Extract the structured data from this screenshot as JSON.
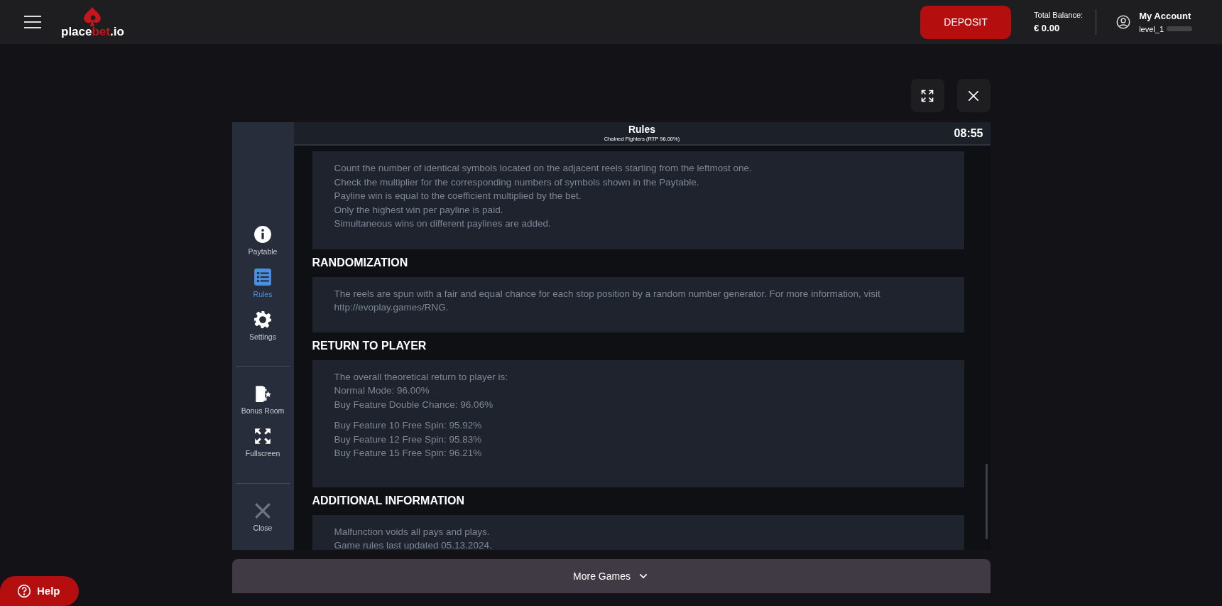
{
  "header": {
    "logo": {
      "start": "place",
      "accent": "bet",
      "end": ".io"
    },
    "deposit_button": "DEPOSIT",
    "balance": {
      "label": "Total Balance:",
      "value": "€ 0.00"
    },
    "account": {
      "title": "My Account",
      "level": "level_1"
    }
  },
  "game": {
    "title": "Rules",
    "subtitle": "Chained Fighters (RTP 96.00%)",
    "time": "08:55",
    "sidebar": [
      [
        {
          "label": "Paytable",
          "selected": false
        },
        {
          "label": "Rules",
          "selected": true
        },
        {
          "label": "Settings",
          "selected": false
        }
      ],
      [
        {
          "label": "Bonus Room",
          "selected": false
        },
        {
          "label": "Fullscreen",
          "selected": false
        }
      ],
      [
        {
          "label": "Close",
          "selected": false
        }
      ]
    ],
    "sections": [
      {
        "groups": [
          [
            "Count the number of identical symbols located on the adjacent reels starting from the leftmost one.",
            "Check the multiplier for the corresponding numbers of symbols shown in the Paytable.",
            "Payline win is equal to the coefficient multiplied by the bet.",
            "Only the highest win per payline is paid.",
            "Simultaneous wins on different paylines are added."
          ]
        ]
      },
      {
        "title": "RANDOMIZATION",
        "groups": [
          [
            "The reels are spun with a fair and equal chance for each stop position by a random number generator. For more information, visit http://evoplay.games/RNG."
          ]
        ]
      },
      {
        "title": "RETURN TO PLAYER",
        "groups": [
          [
            "The overall theoretical return to player is:",
            "Normal Mode: 96.00%",
            "Buy Feature Double Chance: 96.06%"
          ],
          [
            "Buy Feature 10 Free Spin: 95.92%",
            "Buy Feature 12 Free Spin: 95.83%",
            "Buy Feature 15 Free Spin: 96.21%"
          ]
        ]
      },
      {
        "title": "ADDITIONAL INFORMATION",
        "groups": [
          [
            "Malfunction voids all pays and plays.",
            "Game rules last updated 05.13.2024."
          ]
        ]
      }
    ]
  },
  "more_games": "More Games",
  "help_button": "Help"
}
